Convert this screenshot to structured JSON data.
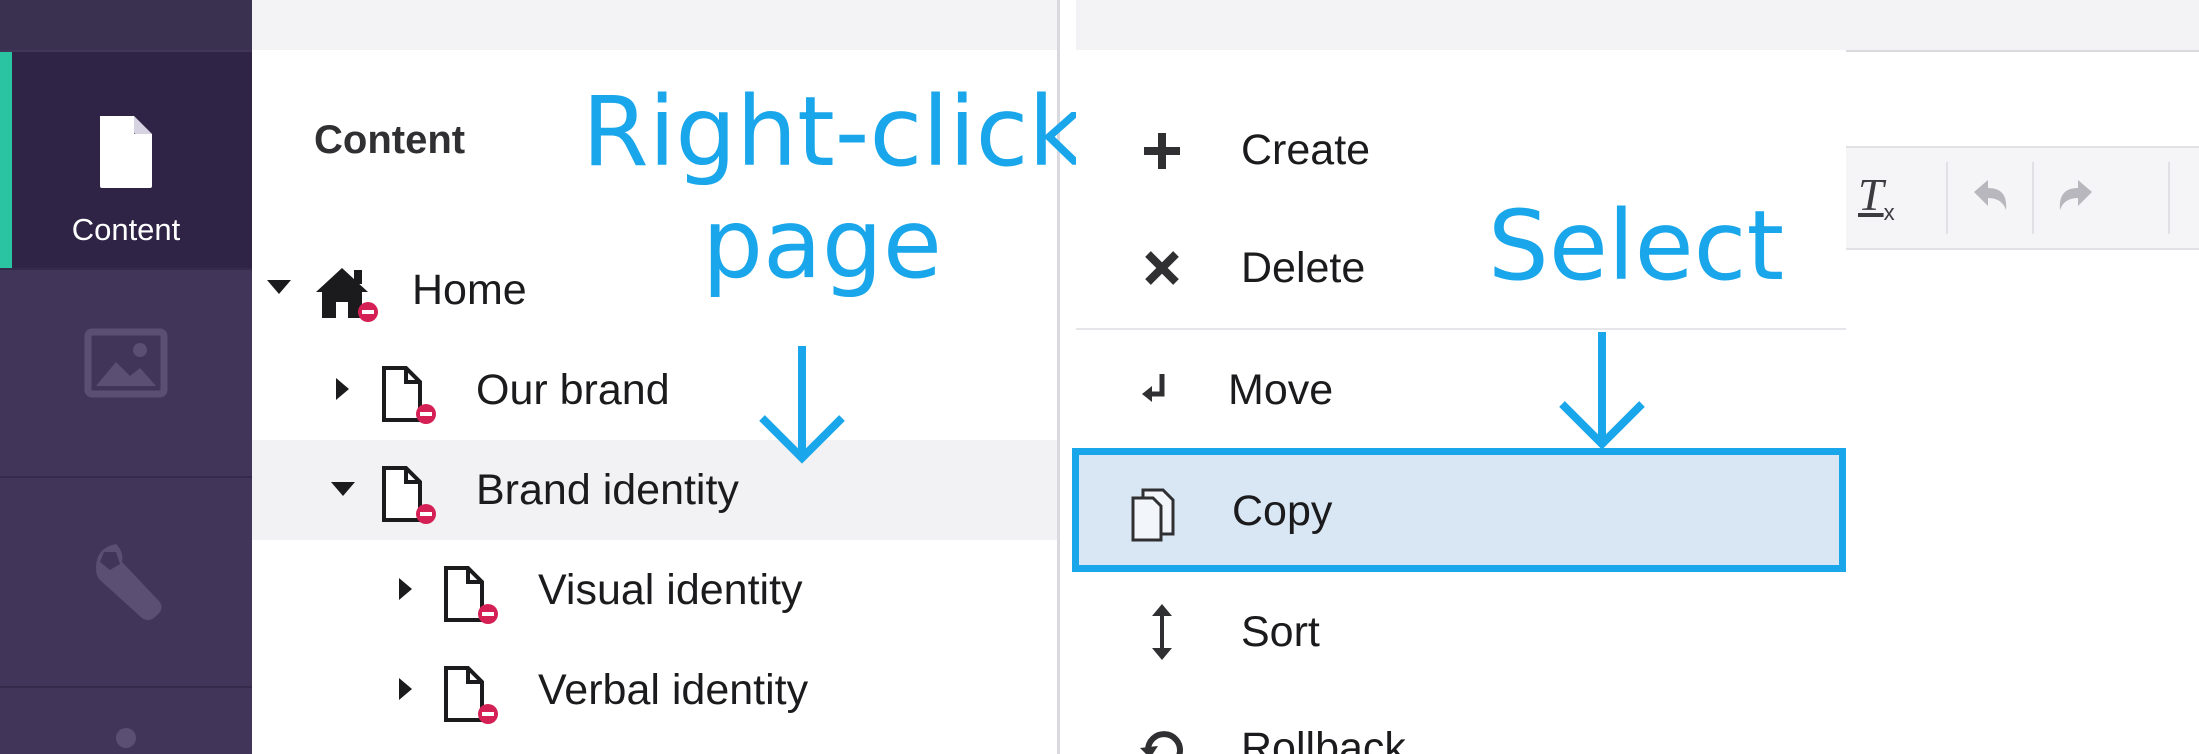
{
  "sidebar": {
    "sections": [
      {
        "label": "Content",
        "icon": "document-icon",
        "active": true
      },
      {
        "label": "",
        "icon": "image-icon",
        "active": false
      },
      {
        "label": "",
        "icon": "wrench-icon",
        "active": false
      }
    ]
  },
  "tree": {
    "title": "Content",
    "nodes": [
      {
        "label": "Home",
        "icon": "home-icon",
        "expanded": true
      },
      {
        "label": "Our brand",
        "icon": "document-icon",
        "expanded": false
      },
      {
        "label": "Brand identity",
        "icon": "document-icon",
        "expanded": true,
        "selected": true
      },
      {
        "label": "Visual identity",
        "icon": "document-icon",
        "expanded": false
      },
      {
        "label": "Verbal identity",
        "icon": "document-icon",
        "expanded": false
      }
    ]
  },
  "menu": {
    "items": [
      {
        "label": "Create",
        "icon": "plus-icon"
      },
      {
        "label": "Delete",
        "icon": "close-icon"
      },
      {
        "label": "Move",
        "icon": "move-icon"
      },
      {
        "label": "Copy",
        "icon": "copy-icon",
        "highlighted": true
      },
      {
        "label": "Sort",
        "icon": "sort-icon"
      },
      {
        "label": "Rollback",
        "icon": "rollback-icon"
      }
    ]
  },
  "editor": {
    "clear_format_label": "T"
  },
  "annotations": {
    "right_click_line1": "Right-click",
    "right_click_line2": "page",
    "select": "Select"
  },
  "colors": {
    "sidebar": "#413659",
    "sidebar_active": "#2f2445",
    "accent": "#2bc4a3",
    "annotation": "#1aa6ea",
    "highlight_fill": "#d9e7f4",
    "unpublished_badge": "#d42054"
  }
}
